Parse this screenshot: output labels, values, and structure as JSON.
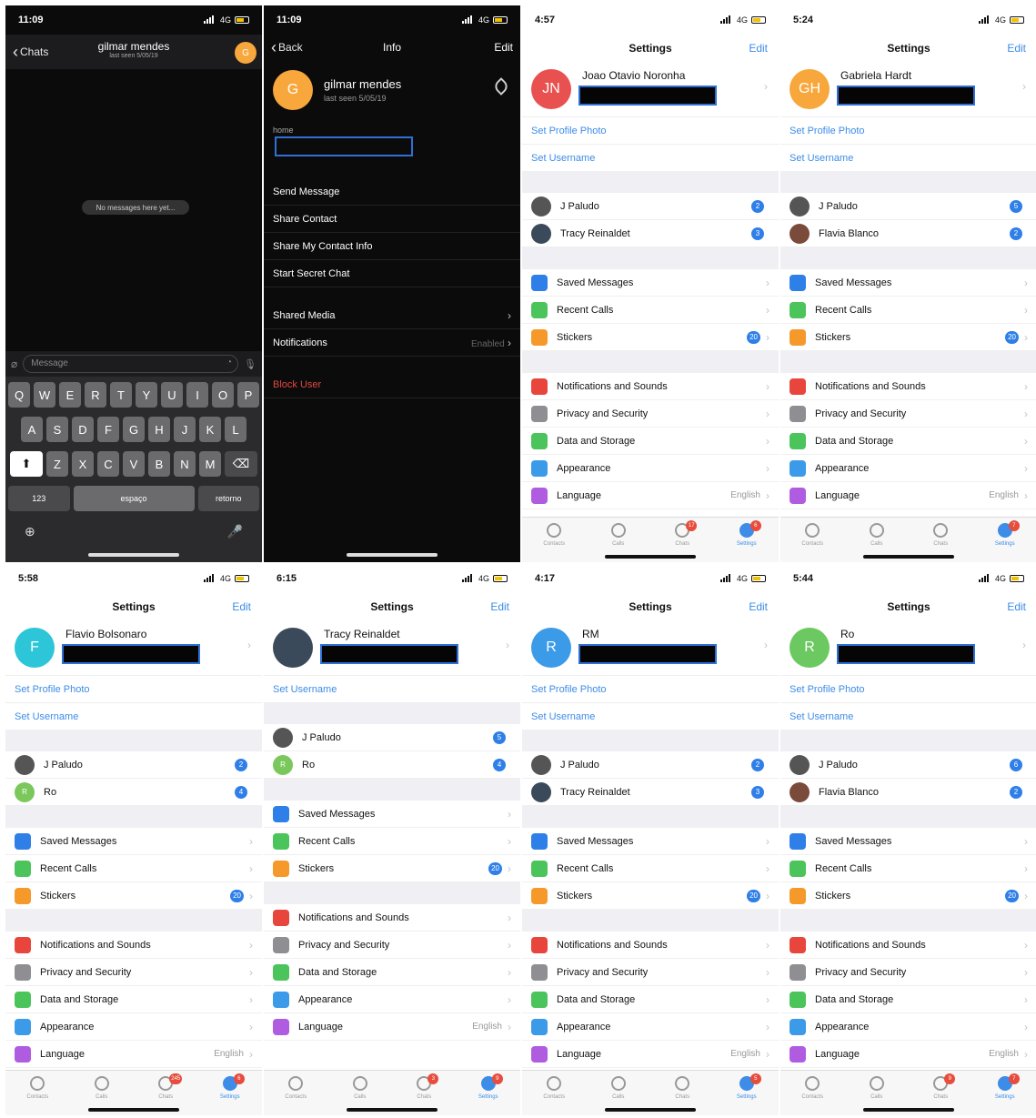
{
  "chat": {
    "time": "11:09",
    "network": "4G",
    "back": "Chats",
    "name": "gilmar mendes",
    "status": "last seen 5/05/19",
    "avatar": "G",
    "empty": "No messages here yet...",
    "placeholder": "Message",
    "keys_row1": [
      "Q",
      "W",
      "E",
      "R",
      "T",
      "Y",
      "U",
      "I",
      "O",
      "P"
    ],
    "keys_row2": [
      "A",
      "S",
      "D",
      "F",
      "G",
      "H",
      "J",
      "K",
      "L"
    ],
    "keys_row3": [
      "Z",
      "X",
      "C",
      "V",
      "B",
      "N",
      "M"
    ],
    "key_num": "123",
    "key_space": "espaço",
    "key_return": "retorno"
  },
  "info": {
    "time": "11:09",
    "network": "4G",
    "back": "Back",
    "title": "Info",
    "edit": "Edit",
    "name": "gilmar mendes",
    "status": "last seen 5/05/19",
    "avatar": "G",
    "home_label": "home",
    "actions": [
      "Send Message",
      "Share Contact",
      "Share My Contact Info",
      "Start Secret Chat"
    ],
    "shared_media": "Shared Media",
    "notifications": "Notifications",
    "notifications_value": "Enabled",
    "block": "Block User"
  },
  "settings_panels": [
    {
      "time": "4:57",
      "name": "Joao Otavio Noronha",
      "initials": "JN",
      "avatar_color": "#e8514f",
      "links": [
        "Set Profile Photo",
        "Set Username"
      ],
      "contacts": [
        {
          "name": "J Paludo",
          "badge": "2",
          "color": "#555"
        },
        {
          "name": "Tracy Reinaldet",
          "badge": "3",
          "color": "#3a4a5a"
        }
      ],
      "chats_badge": "17",
      "settings_badge": "6"
    },
    {
      "time": "5:24",
      "name": "Gabriela Hardt",
      "initials": "GH",
      "avatar_color": "#f7a73b",
      "links": [
        "Set Profile Photo",
        "Set Username"
      ],
      "contacts": [
        {
          "name": "J Paludo",
          "badge": "5",
          "color": "#555"
        },
        {
          "name": "Flavia Blanco",
          "badge": "2",
          "color": "#7a4a3a"
        }
      ],
      "chats_badge": "",
      "settings_badge": "7"
    },
    {
      "time": "5:58",
      "name": "Flavio Bolsonaro",
      "initials": "F",
      "avatar_color": "#2cc6d8",
      "links": [
        "Set Profile Photo",
        "Set Username"
      ],
      "contacts": [
        {
          "name": "J Paludo",
          "badge": "2",
          "color": "#555"
        },
        {
          "name": "Ro",
          "badge": "4",
          "color": "#7ac85c",
          "initial": "R"
        }
      ],
      "chats_badge": "245",
      "settings_badge": "6"
    },
    {
      "time": "6:15",
      "name": "Tracy Reinaldet",
      "initials": "",
      "avatar_color": "#3a4a5a",
      "links": [
        "Set Username"
      ],
      "contacts": [
        {
          "name": "J Paludo",
          "badge": "5",
          "color": "#555"
        },
        {
          "name": "Ro",
          "badge": "4",
          "color": "#7ac85c",
          "initial": "R"
        }
      ],
      "chats_badge": "3",
      "settings_badge": "9"
    },
    {
      "time": "4:17",
      "name": "RM",
      "initials": "R",
      "avatar_color": "#3c9be8",
      "links": [
        "Set Profile Photo",
        "Set Username"
      ],
      "contacts": [
        {
          "name": "J Paludo",
          "badge": "2",
          "color": "#555"
        },
        {
          "name": "Tracy Reinaldet",
          "badge": "3",
          "color": "#3a4a5a"
        }
      ],
      "chats_badge": "",
      "settings_badge": "5"
    },
    {
      "time": "5:44",
      "name": "Ro",
      "initials": "R",
      "avatar_color": "#6cc860",
      "links": [
        "Set Profile Photo",
        "Set Username"
      ],
      "contacts": [
        {
          "name": "J Paludo",
          "badge": "6",
          "color": "#555"
        },
        {
          "name": "Flavia Blanco",
          "badge": "2",
          "color": "#7a4a3a"
        }
      ],
      "chats_badge": "9",
      "settings_badge": "7"
    }
  ],
  "settings_common": {
    "title": "Settings",
    "edit": "Edit",
    "network": "4G",
    "group1": [
      {
        "label": "Saved Messages",
        "color": "#2f7fe8",
        "icon": "bookmark-icon"
      },
      {
        "label": "Recent Calls",
        "color": "#4cc45c",
        "icon": "phone-icon"
      },
      {
        "label": "Stickers",
        "color": "#f59a2a",
        "icon": "sticker-icon",
        "badge": "20"
      }
    ],
    "group2": [
      {
        "label": "Notifications and Sounds",
        "color": "#e8453c",
        "icon": "bell-icon"
      },
      {
        "label": "Privacy and Security",
        "color": "#8e8e93",
        "icon": "lock-icon"
      },
      {
        "label": "Data and Storage",
        "color": "#4cc45c",
        "icon": "database-icon"
      },
      {
        "label": "Appearance",
        "color": "#3c9be8",
        "icon": "brush-icon"
      },
      {
        "label": "Language",
        "color": "#b05ce0",
        "icon": "globe-icon",
        "value": "English"
      }
    ],
    "tabs": [
      "Contacts",
      "Calls",
      "Chats",
      "Settings"
    ]
  }
}
